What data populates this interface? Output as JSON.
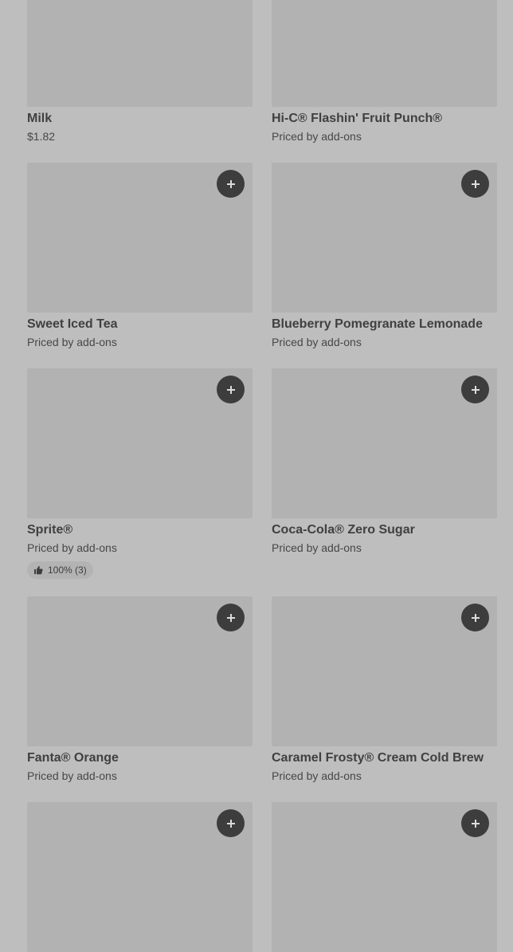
{
  "products": [
    {
      "name": "Milk",
      "price": "$1.82"
    },
    {
      "name": "Hi-C® Flashin' Fruit Punch®",
      "price": "Priced by add-ons"
    },
    {
      "name": "Sweet Iced Tea",
      "price": "Priced by add-ons"
    },
    {
      "name": "Blueberry Pomegranate Lemonade",
      "price": "Priced by add-ons"
    },
    {
      "name": "Sprite®",
      "price": "Priced by add-ons",
      "rating": "100% (3)"
    },
    {
      "name": "Coca-Cola® Zero Sugar",
      "price": "Priced by add-ons"
    },
    {
      "name": "Fanta® Orange",
      "price": "Priced by add-ons"
    },
    {
      "name": "Caramel Frosty® Cream Cold Brew",
      "price": "Priced by add-ons"
    },
    {
      "name": "",
      "price": ""
    },
    {
      "name": "",
      "price": ""
    }
  ],
  "icons": {
    "add": "plus-icon",
    "rating": "thumbs-up-icon"
  }
}
